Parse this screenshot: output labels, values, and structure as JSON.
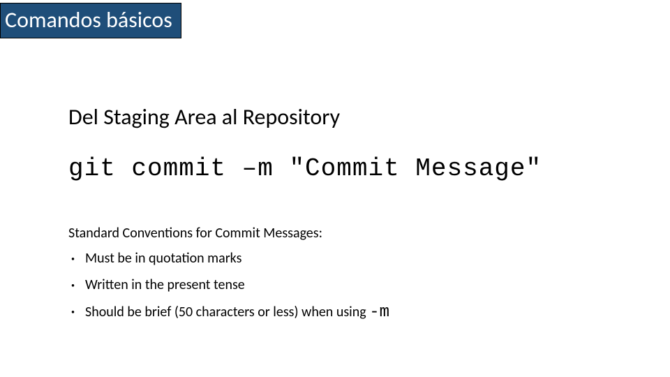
{
  "title": "Comandos básicos",
  "subtitle": "Del Staging Area al Repository",
  "command": "git commit –m \"Commit Message\"",
  "conventions_heading": "Standard Conventions for Commit Messages:",
  "bullets": {
    "b1": "Must be in quotation marks",
    "b2": "Written in the present tense",
    "b3_prefix": "Should be brief (50 characters or less) when using ",
    "b3_code": "-m"
  }
}
